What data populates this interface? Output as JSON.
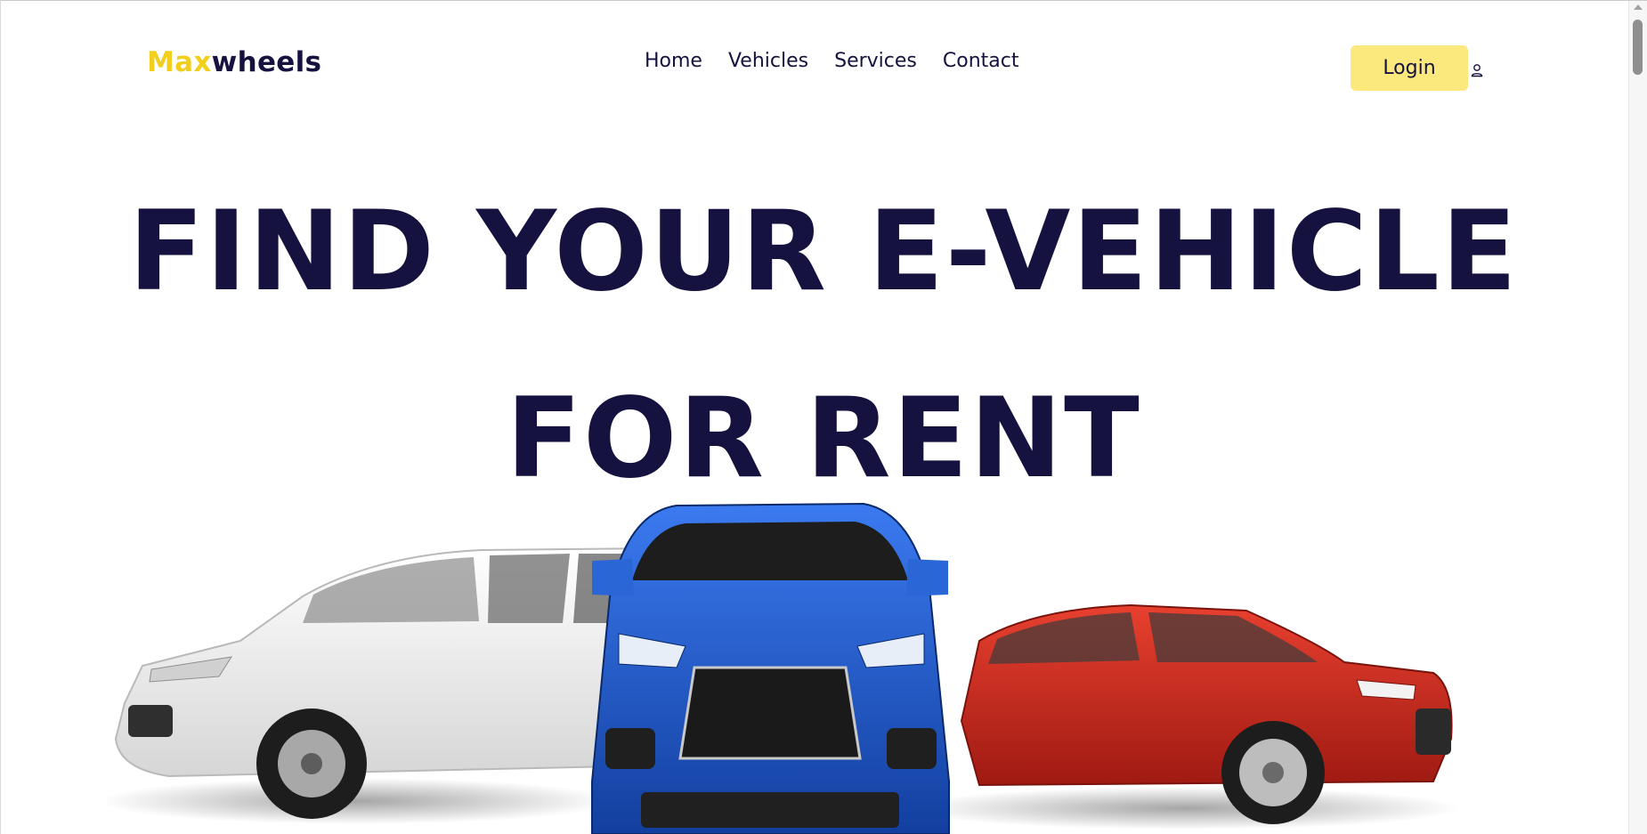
{
  "header": {
    "logo_part1": "Max",
    "logo_part2": "wheels",
    "nav": [
      "Home",
      "Vehicles",
      "Services",
      "Contact"
    ],
    "login_label": "Login",
    "user_icon": "user-icon"
  },
  "hero": {
    "line1": "FIND YOUR E-VEHICLE",
    "line2": "FOR RENT",
    "image": "cars-image"
  },
  "colors": {
    "primary": "#15123f",
    "accent": "#f2cf1d",
    "login_bg": "#fbe97e",
    "car_white": "#f1f1f1",
    "car_blue": "#1f56c4",
    "car_red": "#c9261a"
  }
}
